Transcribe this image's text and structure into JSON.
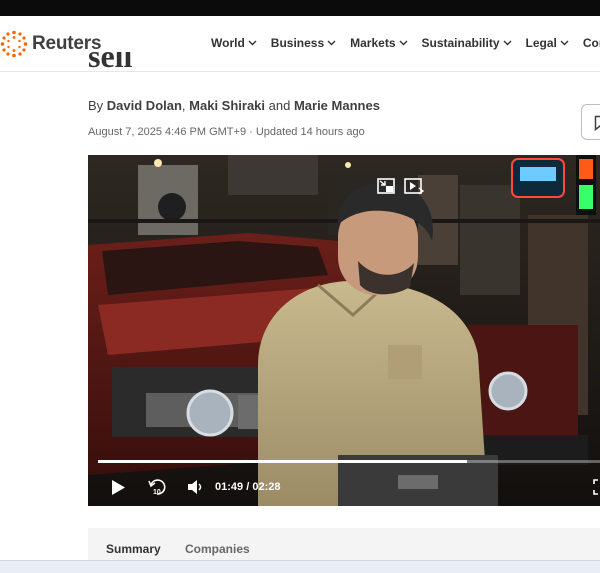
{
  "brand": {
    "name": "Reuters",
    "accent": "#fa6400"
  },
  "nav": {
    "items": [
      {
        "label": "World"
      },
      {
        "label": "Business"
      },
      {
        "label": "Markets"
      },
      {
        "label": "Sustainability"
      },
      {
        "label": "Legal"
      },
      {
        "label": "Comm"
      }
    ]
  },
  "article": {
    "title_fragment": "sell",
    "byline": {
      "prefix": "By ",
      "author1": "David Dolan",
      "sep1": ", ",
      "author2": "Maki Shiraki",
      "sep2": " and ",
      "author3": "Marie Mannes"
    },
    "dateline": "August 7, 2025 4:46 PM GMT+9 · Updated 14 hours ago"
  },
  "video": {
    "current_time": "01:49",
    "separator": "/",
    "duration": "02:28",
    "progress": 0.736,
    "icons": [
      "minimize-icon",
      "picture-in-picture-icon",
      "play-icon",
      "replay-10-icon",
      "volume-icon",
      "fullscreen-icon"
    ]
  },
  "summary": {
    "tabs": [
      {
        "label": "Summary",
        "active": true
      },
      {
        "label": "Companies",
        "active": false
      }
    ]
  },
  "icons": {
    "save": "bookmark-icon",
    "chevron": "chevron-down-icon"
  }
}
